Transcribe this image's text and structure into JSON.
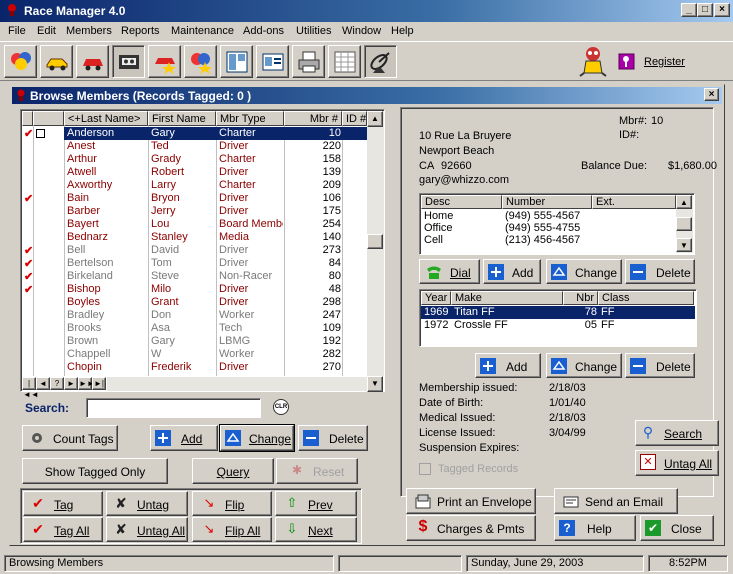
{
  "app": {
    "title": "Race Manager 4.0",
    "register": "Register"
  },
  "menu": [
    "File",
    "Edit",
    "Members",
    "Reports",
    "Maintenance",
    "Add-ons",
    "Utilities",
    "Window",
    "Help"
  ],
  "toolbar_icons": [
    "balloons-icon",
    "race-car-icon",
    "red-car-icon",
    "cassette-icon",
    "car-star-icon",
    "balloons-star-icon",
    "layout-icon",
    "id-card-icon",
    "printer-icon",
    "spreadsheet-icon",
    "satellite-icon"
  ],
  "browse": {
    "title": "Browse Members  (Records Tagged:  0 )",
    "columns": [
      "<+Last Name>",
      "First Name",
      "Mbr Type",
      "Mbr #",
      "ID #"
    ],
    "rows": [
      {
        "tag": true,
        "last": "Anderson",
        "first": "Gary",
        "type": "Charter",
        "mbr": "10",
        "style": "sel"
      },
      {
        "tag": false,
        "last": "Anest",
        "first": "Ted",
        "type": "Driver",
        "mbr": "220",
        "style": "red"
      },
      {
        "tag": false,
        "last": "Arthur",
        "first": "Grady",
        "type": "Charter",
        "mbr": "158",
        "style": "red"
      },
      {
        "tag": false,
        "last": "Atwell",
        "first": "Robert",
        "type": "Driver",
        "mbr": "139",
        "style": "red"
      },
      {
        "tag": false,
        "last": "Axworthy",
        "first": "Larry",
        "type": "Charter",
        "mbr": "209",
        "style": "red"
      },
      {
        "tag": true,
        "last": "Bain",
        "first": "Bryon",
        "type": "Driver",
        "mbr": "106",
        "style": "red"
      },
      {
        "tag": false,
        "last": "Barber",
        "first": "Jerry",
        "type": "Driver",
        "mbr": "175",
        "style": "red"
      },
      {
        "tag": false,
        "last": "Bayert",
        "first": "Lou",
        "type": "Board Member",
        "mbr": "254",
        "style": "red"
      },
      {
        "tag": false,
        "last": "Bednarz",
        "first": "Stanley",
        "type": "Media",
        "mbr": "140",
        "style": "red"
      },
      {
        "tag": true,
        "last": "Bell",
        "first": "David",
        "type": "Driver",
        "mbr": "273",
        "style": "gray"
      },
      {
        "tag": true,
        "last": "Bertelson",
        "first": "Tom",
        "type": "Driver",
        "mbr": "84",
        "style": "gray"
      },
      {
        "tag": true,
        "last": "Birkeland",
        "first": "Steve",
        "type": "Non-Racer",
        "mbr": "80",
        "style": "gray"
      },
      {
        "tag": true,
        "last": "Bishop",
        "first": "Milo",
        "type": "Driver",
        "mbr": "48",
        "style": "red"
      },
      {
        "tag": false,
        "last": "Boyles",
        "first": "Grant",
        "type": "Driver",
        "mbr": "298",
        "style": "red"
      },
      {
        "tag": false,
        "last": "Bradley",
        "first": "Don",
        "type": "Worker",
        "mbr": "247",
        "style": "gray"
      },
      {
        "tag": false,
        "last": "Brooks",
        "first": "Asa",
        "type": "Tech",
        "mbr": "109",
        "style": "gray"
      },
      {
        "tag": false,
        "last": "Brown",
        "first": "Gary",
        "type": "LBMG",
        "mbr": "192",
        "style": "gray"
      },
      {
        "tag": false,
        "last": "Chappell",
        "first": "W",
        "type": "Worker",
        "mbr": "282",
        "style": "gray"
      },
      {
        "tag": false,
        "last": "Chopin",
        "first": "Frederik",
        "type": "Driver",
        "mbr": "270",
        "style": "red"
      }
    ],
    "nav": [
      "|◄◄",
      "◄",
      "?",
      "►",
      "►►",
      "►|"
    ],
    "search_label": "Search:",
    "search_value": "",
    "clr": "CLR"
  },
  "buttons": {
    "count_tags": "Count Tags",
    "add": "Add",
    "change": "Change",
    "delete": "Delete",
    "show_tagged": "Show Tagged Only",
    "query": "Query",
    "reset": "Reset",
    "tag": "Tag",
    "untag": "Untag",
    "flip": "Flip",
    "prev": "Prev",
    "tag_all": "Tag All",
    "untag_all": "Untag All",
    "flip_all": "Flip All",
    "next": "Next"
  },
  "detail": {
    "mbr_label": "Mbr#:",
    "mbr": "10",
    "id_label": "ID#:",
    "id": "",
    "addr1": "10 Rue La Bruyere",
    "city": "Newport Beach",
    "state": "CA",
    "zip": "92660",
    "balance_label": "Balance Due:",
    "balance": "$1,680.00",
    "email": "gary@whizzo.com",
    "phone_cols": [
      "Desc",
      "Number",
      "Ext."
    ],
    "phones": [
      {
        "desc": "Home",
        "number": "(949) 555-4567",
        "ext": ""
      },
      {
        "desc": "Office",
        "number": "(949) 555-4755",
        "ext": ""
      },
      {
        "desc": "Cell",
        "number": "(213) 456-4567",
        "ext": ""
      }
    ],
    "dial": "Dial",
    "car_cols": [
      "Year",
      "Make",
      "Nbr",
      "Class"
    ],
    "cars": [
      {
        "year": "1969",
        "make": "Titan FF",
        "nbr": "78",
        "cls": "FF"
      },
      {
        "year": "1972",
        "make": "Crossle FF",
        "nbr": "05",
        "cls": "FF"
      }
    ],
    "info": [
      {
        "label": "Membership issued:",
        "value": "2/18/03"
      },
      {
        "label": "Date of Birth:",
        "value": "1/01/40"
      },
      {
        "label": "Medical Issued:",
        "value": "2/18/03"
      },
      {
        "label": "License Issued:",
        "value": "3/04/99"
      },
      {
        "label": "Suspension Expires:",
        "value": ""
      }
    ],
    "tagged_records": "Tagged Records",
    "search": "Search",
    "untag_all": "Untag All",
    "print_env": "Print an Envelope",
    "send_email": "Send an Email",
    "charges": "Charges & Pmts",
    "help": "Help",
    "close": "Close"
  },
  "status": {
    "msg": "Browsing Members",
    "date": "Sunday, June 29, 2003",
    "time": "8:52PM"
  }
}
